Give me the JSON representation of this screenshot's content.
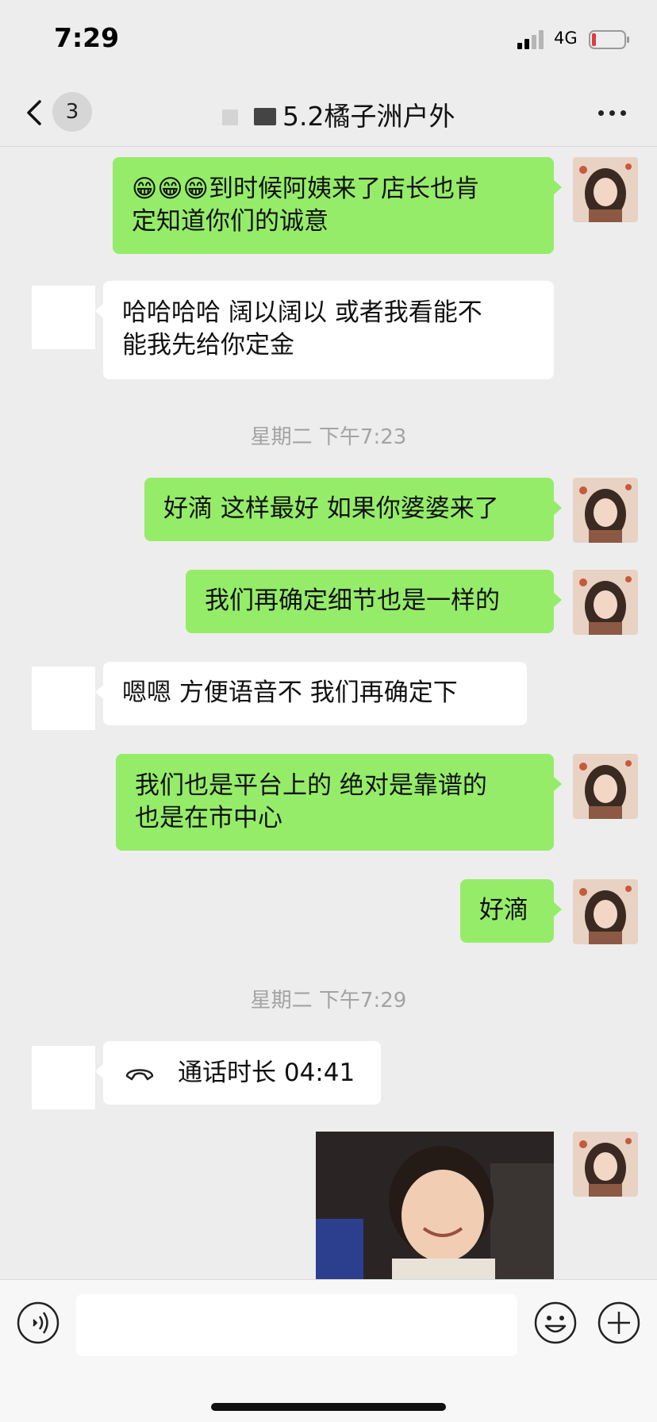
{
  "status_bar": {
    "time": "7:29",
    "network": "4G",
    "battery_color": "#e23b3b"
  },
  "nav": {
    "badge_count": "3",
    "title": "5.2橘子洲户外"
  },
  "messages": [
    {
      "type": "sent",
      "text_line1": "😁😁😁到时候阿姨来了店长也肯",
      "text_line2": "定知道你们的诚意"
    },
    {
      "type": "recv",
      "text_line1": "哈哈哈哈  阔以阔以  或者我看能不",
      "text_line2": "能我先给你定金"
    },
    {
      "type": "timestamp",
      "text": "星期二 下午7:23"
    },
    {
      "type": "sent",
      "text": "好滴 这样最好 如果你婆婆来了"
    },
    {
      "type": "sent",
      "text": "我们再确定细节也是一样的"
    },
    {
      "type": "recv",
      "text": "嗯嗯 方便语音不  我们再确定下"
    },
    {
      "type": "sent",
      "text_line1": "我们也是平台上的 绝对是靠谱的",
      "text_line2": "也是在市中心"
    },
    {
      "type": "sent",
      "text": "好滴"
    },
    {
      "type": "timestamp",
      "text": "星期二 下午7:29"
    },
    {
      "type": "call",
      "text": "通话时长 04:41"
    },
    {
      "type": "photo",
      "icon": "photo-thumbnail"
    }
  ],
  "colors": {
    "sent_bubble": "#95ec69",
    "recv_bubble": "#ffffff",
    "background": "#ededed"
  },
  "input": {
    "placeholder": ""
  },
  "icons": {
    "back": "chevron-left-icon",
    "more": "more-dots-icon",
    "voice": "voice-icon",
    "emoji": "emoji-icon",
    "plus": "plus-icon",
    "call": "phone-hangup-icon"
  }
}
